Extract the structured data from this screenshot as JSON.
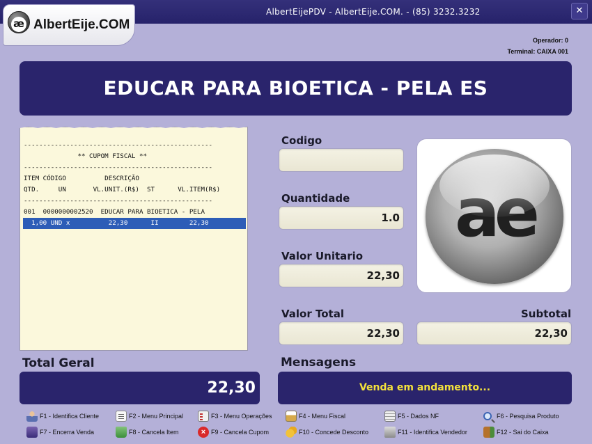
{
  "window": {
    "title": "AlbertEijePDV - AlbertEije.COM. - (85) 3232.3232",
    "close_label": "✕"
  },
  "brand": {
    "name": "AlbertEije.COM",
    "logo_glyph": "æ"
  },
  "session": {
    "operator": "Operador: 0",
    "terminal": "Terminal: CAIXA 001"
  },
  "product_banner": "EDUCAR PARA BIOETICA - PELA ES",
  "receipt": {
    "lines": [
      "-------------------------------------------------",
      "              ** CUPOM FISCAL **",
      "-------------------------------------------------",
      "ITEM CÓDIGO          DESCRIÇÃO",
      "QTD.     UN       VL.UNIT.(R$)  ST      VL.ITEM(R$)",
      "-------------------------------------------------",
      "001  0000000002520  EDUCAR PARA BIOETICA - PELA"
    ],
    "selected_line": "  1,00 UND x          22,30      II        22,30"
  },
  "fields": {
    "codigo_label": "Codigo",
    "codigo_value": "",
    "quantidade_label": "Quantidade",
    "quantidade_value": "1.0",
    "valor_unitario_label": "Valor Unitario",
    "valor_unitario_value": "22,30",
    "valor_total_label": "Valor Total",
    "valor_total_value": "22,30",
    "subtotal_label": "Subtotal",
    "subtotal_value": "22,30"
  },
  "logo_card": {
    "glyph": "ae"
  },
  "total": {
    "label": "Total Geral",
    "value": "22,30"
  },
  "messages": {
    "label": "Mensagens",
    "text": "Venda em andamento..."
  },
  "shortcuts": [
    {
      "label": "F1 - Identifica Cliente",
      "icon": "person-icon"
    },
    {
      "label": "F2 - Menu Principal",
      "icon": "document-icon"
    },
    {
      "label": "F3 - Menu Operações",
      "icon": "checklist-icon"
    },
    {
      "label": "F4 - Menu Fiscal",
      "icon": "fiscal-icon"
    },
    {
      "label": "F5 - Dados NF",
      "icon": "spreadsheet-icon"
    },
    {
      "label": "F6 - Pesquisa Produto",
      "icon": "magnifier-icon"
    },
    {
      "label": "F7 - Encerra Venda",
      "icon": "cart-icon"
    },
    {
      "label": "F8 - Cancela Item",
      "icon": "recycle-icon"
    },
    {
      "label": "F9 - Cancela Cupom",
      "icon": "cancel-icon"
    },
    {
      "label": "F10 - Concede Desconto",
      "icon": "coins-icon"
    },
    {
      "label": "F11 - Identifica Vendedor",
      "icon": "cash-register-icon"
    },
    {
      "label": "F12 - Sai do Caixa",
      "icon": "exit-door-icon"
    }
  ]
}
